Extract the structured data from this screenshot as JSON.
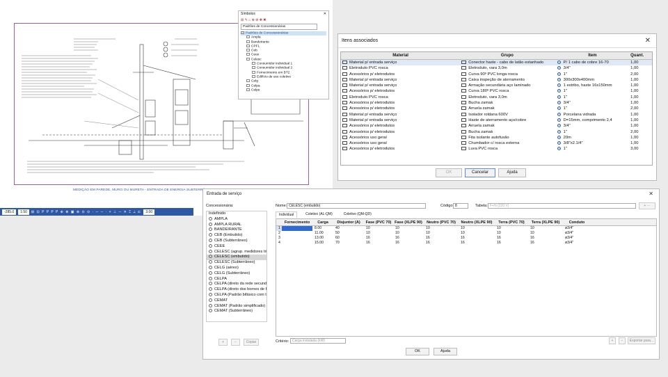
{
  "cad": {
    "caption": "MEDIÇÃO EM PAREDE, MURO OU MURETA - ENTRADA DE ENERGIA SUBTERRÂNEA",
    "toolbar": {
      "coord": "-285.0",
      "scale": "1:50",
      "zoom": "3.00",
      "icons": "⊞ ⊡ P P P P ⊕ ⊗ ▣ ⊕ ⊙ ⊙ · ─ ─ · + ⊥ ─ ✕ ⌶ ⟂ ⊏"
    }
  },
  "library": {
    "title": "Símbolos",
    "close": "✕",
    "tools": "⊞ ✎ ⌂ ⊗ ⊛ ✚ ✖",
    "selector": "Padrões de Concessionárias",
    "items": [
      {
        "label": "Padrões de Concessionárias",
        "sel": true
      },
      {
        "label": "Ampla"
      },
      {
        "label": "Bandeirante"
      },
      {
        "label": "CPFL"
      },
      {
        "label": "Ceb"
      },
      {
        "label": "Ceee"
      },
      {
        "label": "Celesc"
      },
      {
        "label": "Consumidor individual 1"
      },
      {
        "label": "Consumidor individual 2"
      },
      {
        "label": "Fornecimento em BT2"
      },
      {
        "label": "Edifício de uso coletivo"
      },
      {
        "label": "Celg"
      },
      {
        "label": "Celpa"
      },
      {
        "label": "Celpe"
      }
    ]
  },
  "itens": {
    "title": "Itens associados",
    "close": "✕",
    "headers": [
      "Material",
      "Grupo",
      "Item",
      "Quant."
    ],
    "rows": [
      [
        "Material p/ entrada serviço",
        "Conector haste - cabo de latão estanhado",
        "P/ 1 cabo de cobre 16-70",
        "1,00"
      ],
      [
        "Eletroduto PVC rosca",
        "Eletroduto, vara 3,0m",
        "3/4\"",
        "1,00"
      ],
      [
        "Acessórios p/ eletrodutos",
        "Curva 90º PVC longa rosca",
        "1\"",
        "2,00"
      ],
      [
        "Material p/ entrada serviço",
        "Caixa inspeção de aterramento",
        "300x300x400mm",
        "1,00"
      ],
      [
        "Material p/ entrada serviço",
        "Armação secundária aço laminado",
        "1 estribo, haste 16x150mm",
        "1,00"
      ],
      [
        "Acessórios p/ eletrodutos",
        "Curva 180º PVC rosca",
        "1\"",
        "1,00"
      ],
      [
        "Eletroduto PVC rosca",
        "Eletroduto, vara 3,0m",
        "1\"",
        "1,00"
      ],
      [
        "Acessórios p/ eletrodutos",
        "Bucha zamak",
        "3/4\"",
        "1,00"
      ],
      [
        "Acessórios p/ eletrodutos",
        "Arruela zamak",
        "1\"",
        "2,00"
      ],
      [
        "Material p/ entrada serviço",
        "Isolador roldana 600V",
        "Porcelana vidrada",
        "1,00"
      ],
      [
        "Material p/ entrada serviço",
        "Haste de aterramento aço/cobre",
        "D=15mm, comprimento 2,4",
        "1,00"
      ],
      [
        "Acessórios p/ eletrodutos",
        "Arruela zamak",
        "3/4\"",
        "1,00"
      ],
      [
        "Acessórios p/ eletrodutos",
        "Bucha zamak",
        "1\"",
        "2,00"
      ],
      [
        "Acessórios uso geral",
        "Fita isolante autofusão",
        "20m",
        "1,00"
      ],
      [
        "Acessórios uso geral",
        "Chumbador c/ rosca externa",
        "3/8\"x2.1/4\"",
        "1,00"
      ],
      [
        "Acessórios p/ eletrodutos",
        "Luva PVC rosca",
        "1\"",
        "3,00"
      ]
    ],
    "buttons": {
      "ok": "OK",
      "cancel": "Cancelar",
      "help": "Ajuda"
    }
  },
  "entrada": {
    "title": "Entrada de serviço",
    "close": "✕",
    "conc_label": "Concessionária:",
    "nome_label": "Nome:",
    "nome_value": "CELESC (embutido)",
    "codigo_label": "Código:",
    "codigo_value": "8",
    "tabela_label": "Tabela:",
    "tabela_value": "F+N (220 V)",
    "conc_items": [
      "Indefinido",
      "AMPLA",
      "AMPLA RURAL",
      "BANDEIRANTE",
      "CEB (Embutido)",
      "CEB (Subterrâneo)",
      "CEEE",
      "CELESC (agrup. medidores trifá",
      "CELESC (embutido)",
      "CELESC (Subterrâneo)",
      "CELG (aéreo)",
      "CELG (Subterrâneo)",
      "CELPA",
      "CELPA (direto da rede secundá",
      "CELPA (direto dos bornes de B",
      "CELPA (Padrão bifásico com tr",
      "CEMAT",
      "CEMAT (Padrão simplificado)",
      "CEMAT (Subterrâneo)"
    ],
    "conc_selected": 8,
    "tabs": [
      "Individual",
      "Coletivo (AL-QM)",
      "Coletivo (QM-QD)"
    ],
    "grid_headers": [
      "",
      "Fornecimento",
      "Carga",
      "Disjuntor (A)",
      "Fase (PVC 70)",
      "Fase (XLPE 90)",
      "Neutro (PVC 70)",
      "Neutro (XLPE 90)",
      "Terra (PVC 70)",
      "Terra (XLPE 90)",
      "Conduto"
    ],
    "grid_rows": [
      [
        "1",
        "",
        "8.00",
        "40",
        "10",
        "10",
        "10",
        "10",
        "10",
        "10",
        "ø3/4\""
      ],
      [
        "2",
        "",
        "11.00",
        "50",
        "10",
        "10",
        "10",
        "10",
        "10",
        "10",
        "ø3/4\""
      ],
      [
        "3",
        "",
        "13.00",
        "60",
        "16",
        "16",
        "16",
        "16",
        "16",
        "16",
        "ø3/4\""
      ],
      [
        "4",
        "",
        "15.00",
        "70",
        "16",
        "16",
        "16",
        "16",
        "16",
        "16",
        "ø3/4\""
      ]
    ],
    "criterio_label": "Critério:",
    "criterio_value": "Carga instalada (kW)",
    "copy_btn": "Copiar",
    "export_btn": "Exportar para...",
    "ok": "OK",
    "help": "Ajuda"
  }
}
